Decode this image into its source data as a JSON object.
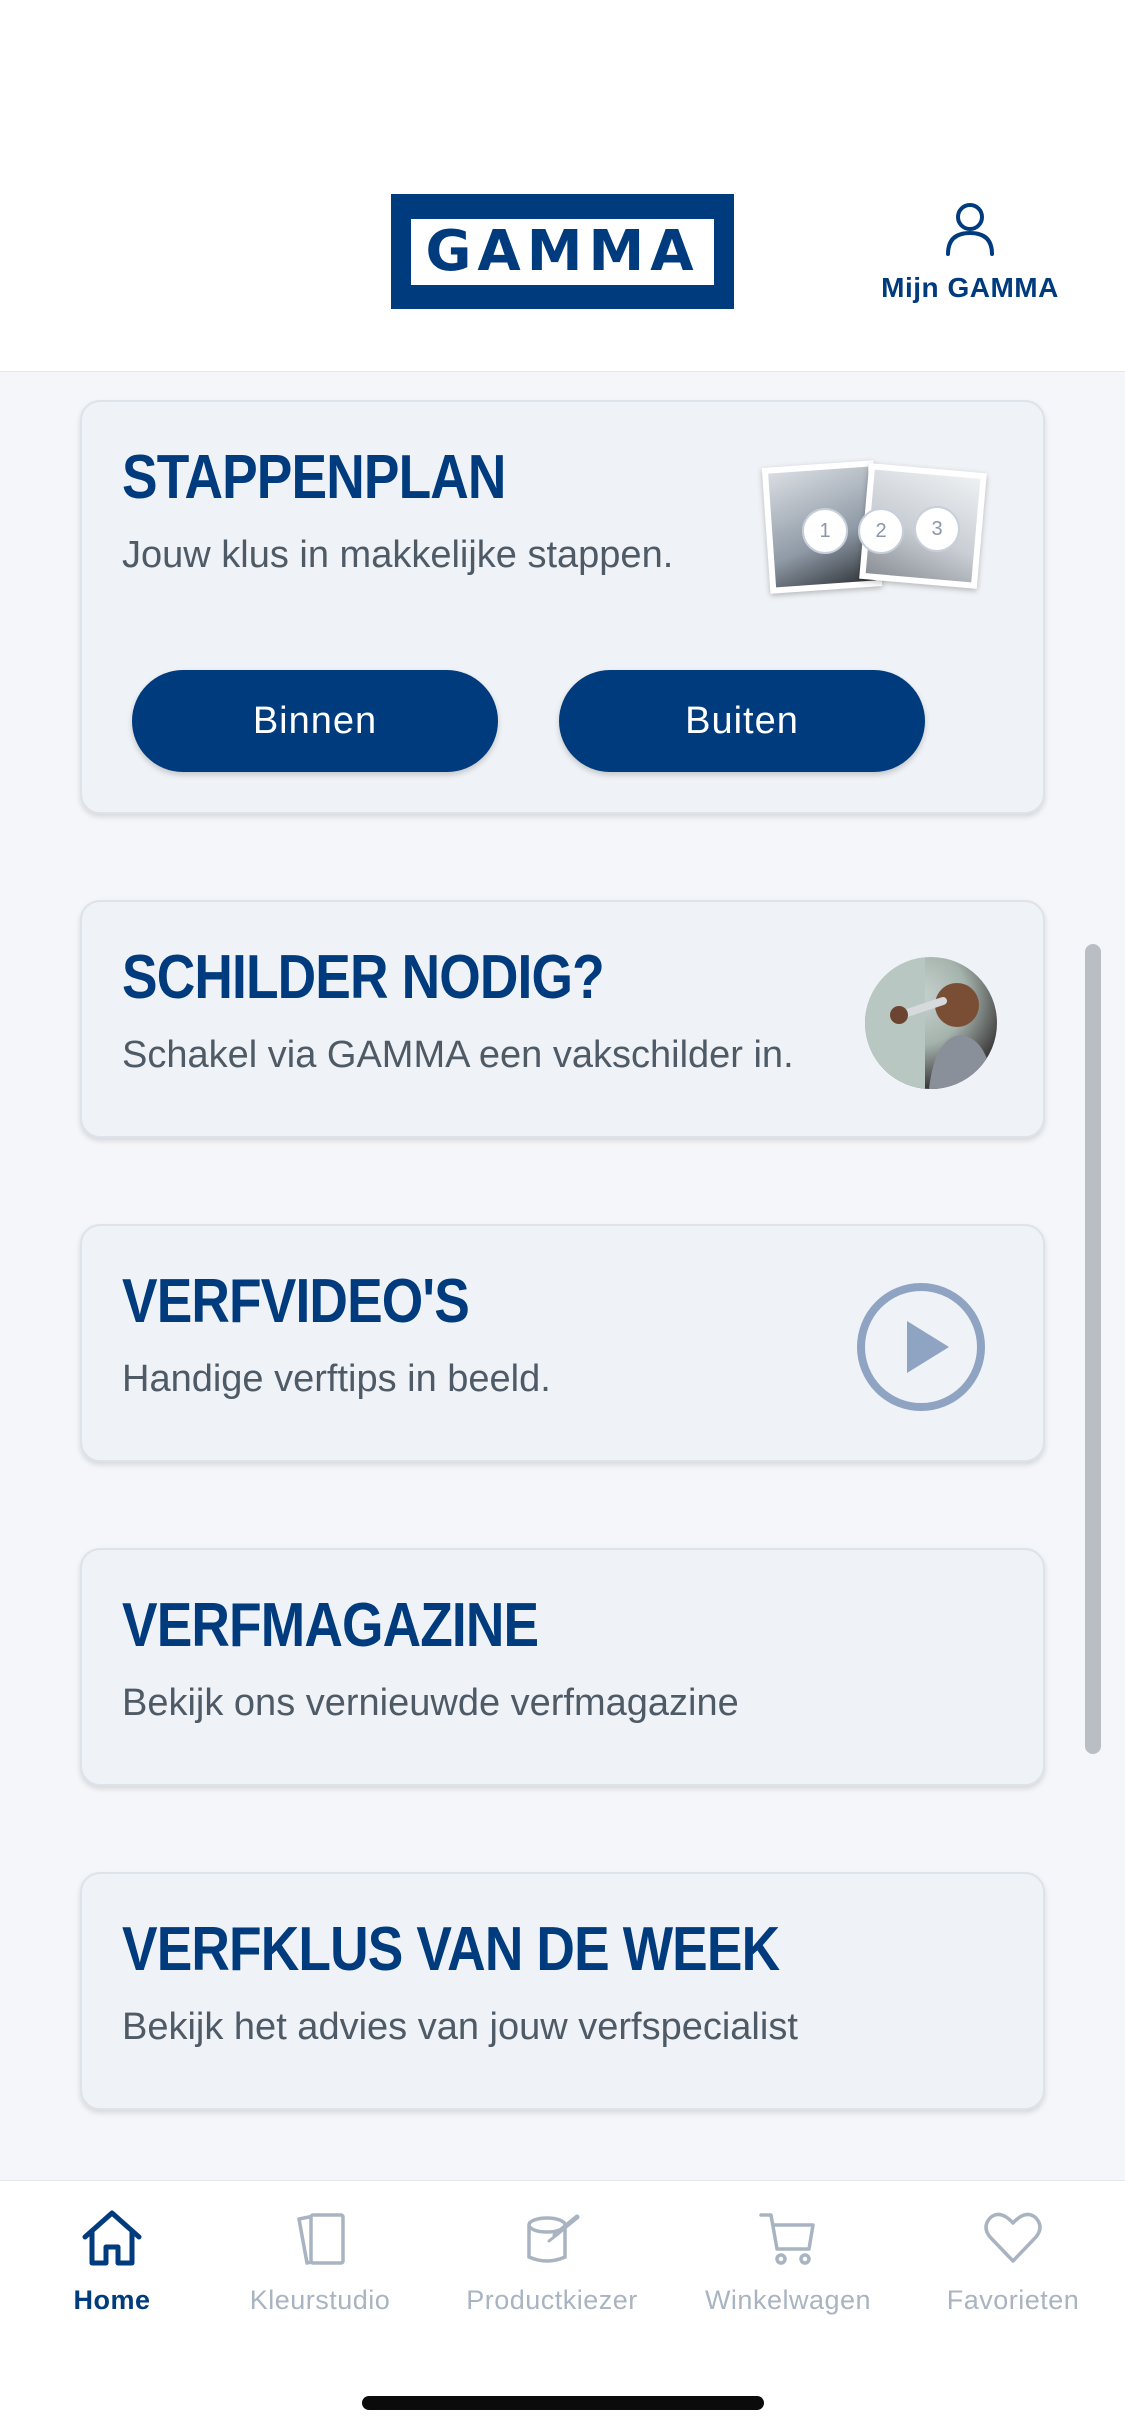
{
  "header": {
    "logo_text": "GAMMA",
    "account_label": "Mijn GAMMA",
    "account_icon": "user-icon"
  },
  "cards": {
    "stappenplan": {
      "title": "STAPPENPLAN",
      "subtitle": "Jouw klus in makkelijke stappen.",
      "step_numbers": [
        "1",
        "2",
        "3"
      ],
      "buttons": {
        "inside": "Binnen",
        "outside": "Buiten"
      }
    },
    "schilder": {
      "title": "SCHILDER NODIG?",
      "subtitle": "Schakel via GAMMA een vakschilder in."
    },
    "verfvideos": {
      "title": "VERFVIDEO'S",
      "subtitle": "Handige verftips in beeld.",
      "icon": "play-icon"
    },
    "verfmagazine": {
      "title": "VERFMAGAZINE",
      "subtitle": "Bekijk ons vernieuwde verfmagazine"
    },
    "verfklus": {
      "title": "VERFKLUS VAN DE WEEK",
      "subtitle": "Bekijk het advies van jouw verfspecialist"
    }
  },
  "tabbar": {
    "items": [
      {
        "label": "Home",
        "icon": "home-icon",
        "active": true
      },
      {
        "label": "Kleurstudio",
        "icon": "color-cards-icon",
        "active": false
      },
      {
        "label": "Productkiezer",
        "icon": "paint-can-icon",
        "active": false
      },
      {
        "label": "Winkelwagen",
        "icon": "cart-icon",
        "active": false
      },
      {
        "label": "Favorieten",
        "icon": "heart-icon",
        "active": false
      }
    ]
  },
  "colors": {
    "brand": "#003b7e",
    "card_bg": "#eff2f6",
    "inactive_tab": "#a9b4c2",
    "play_icon": "#8fa3c2"
  }
}
